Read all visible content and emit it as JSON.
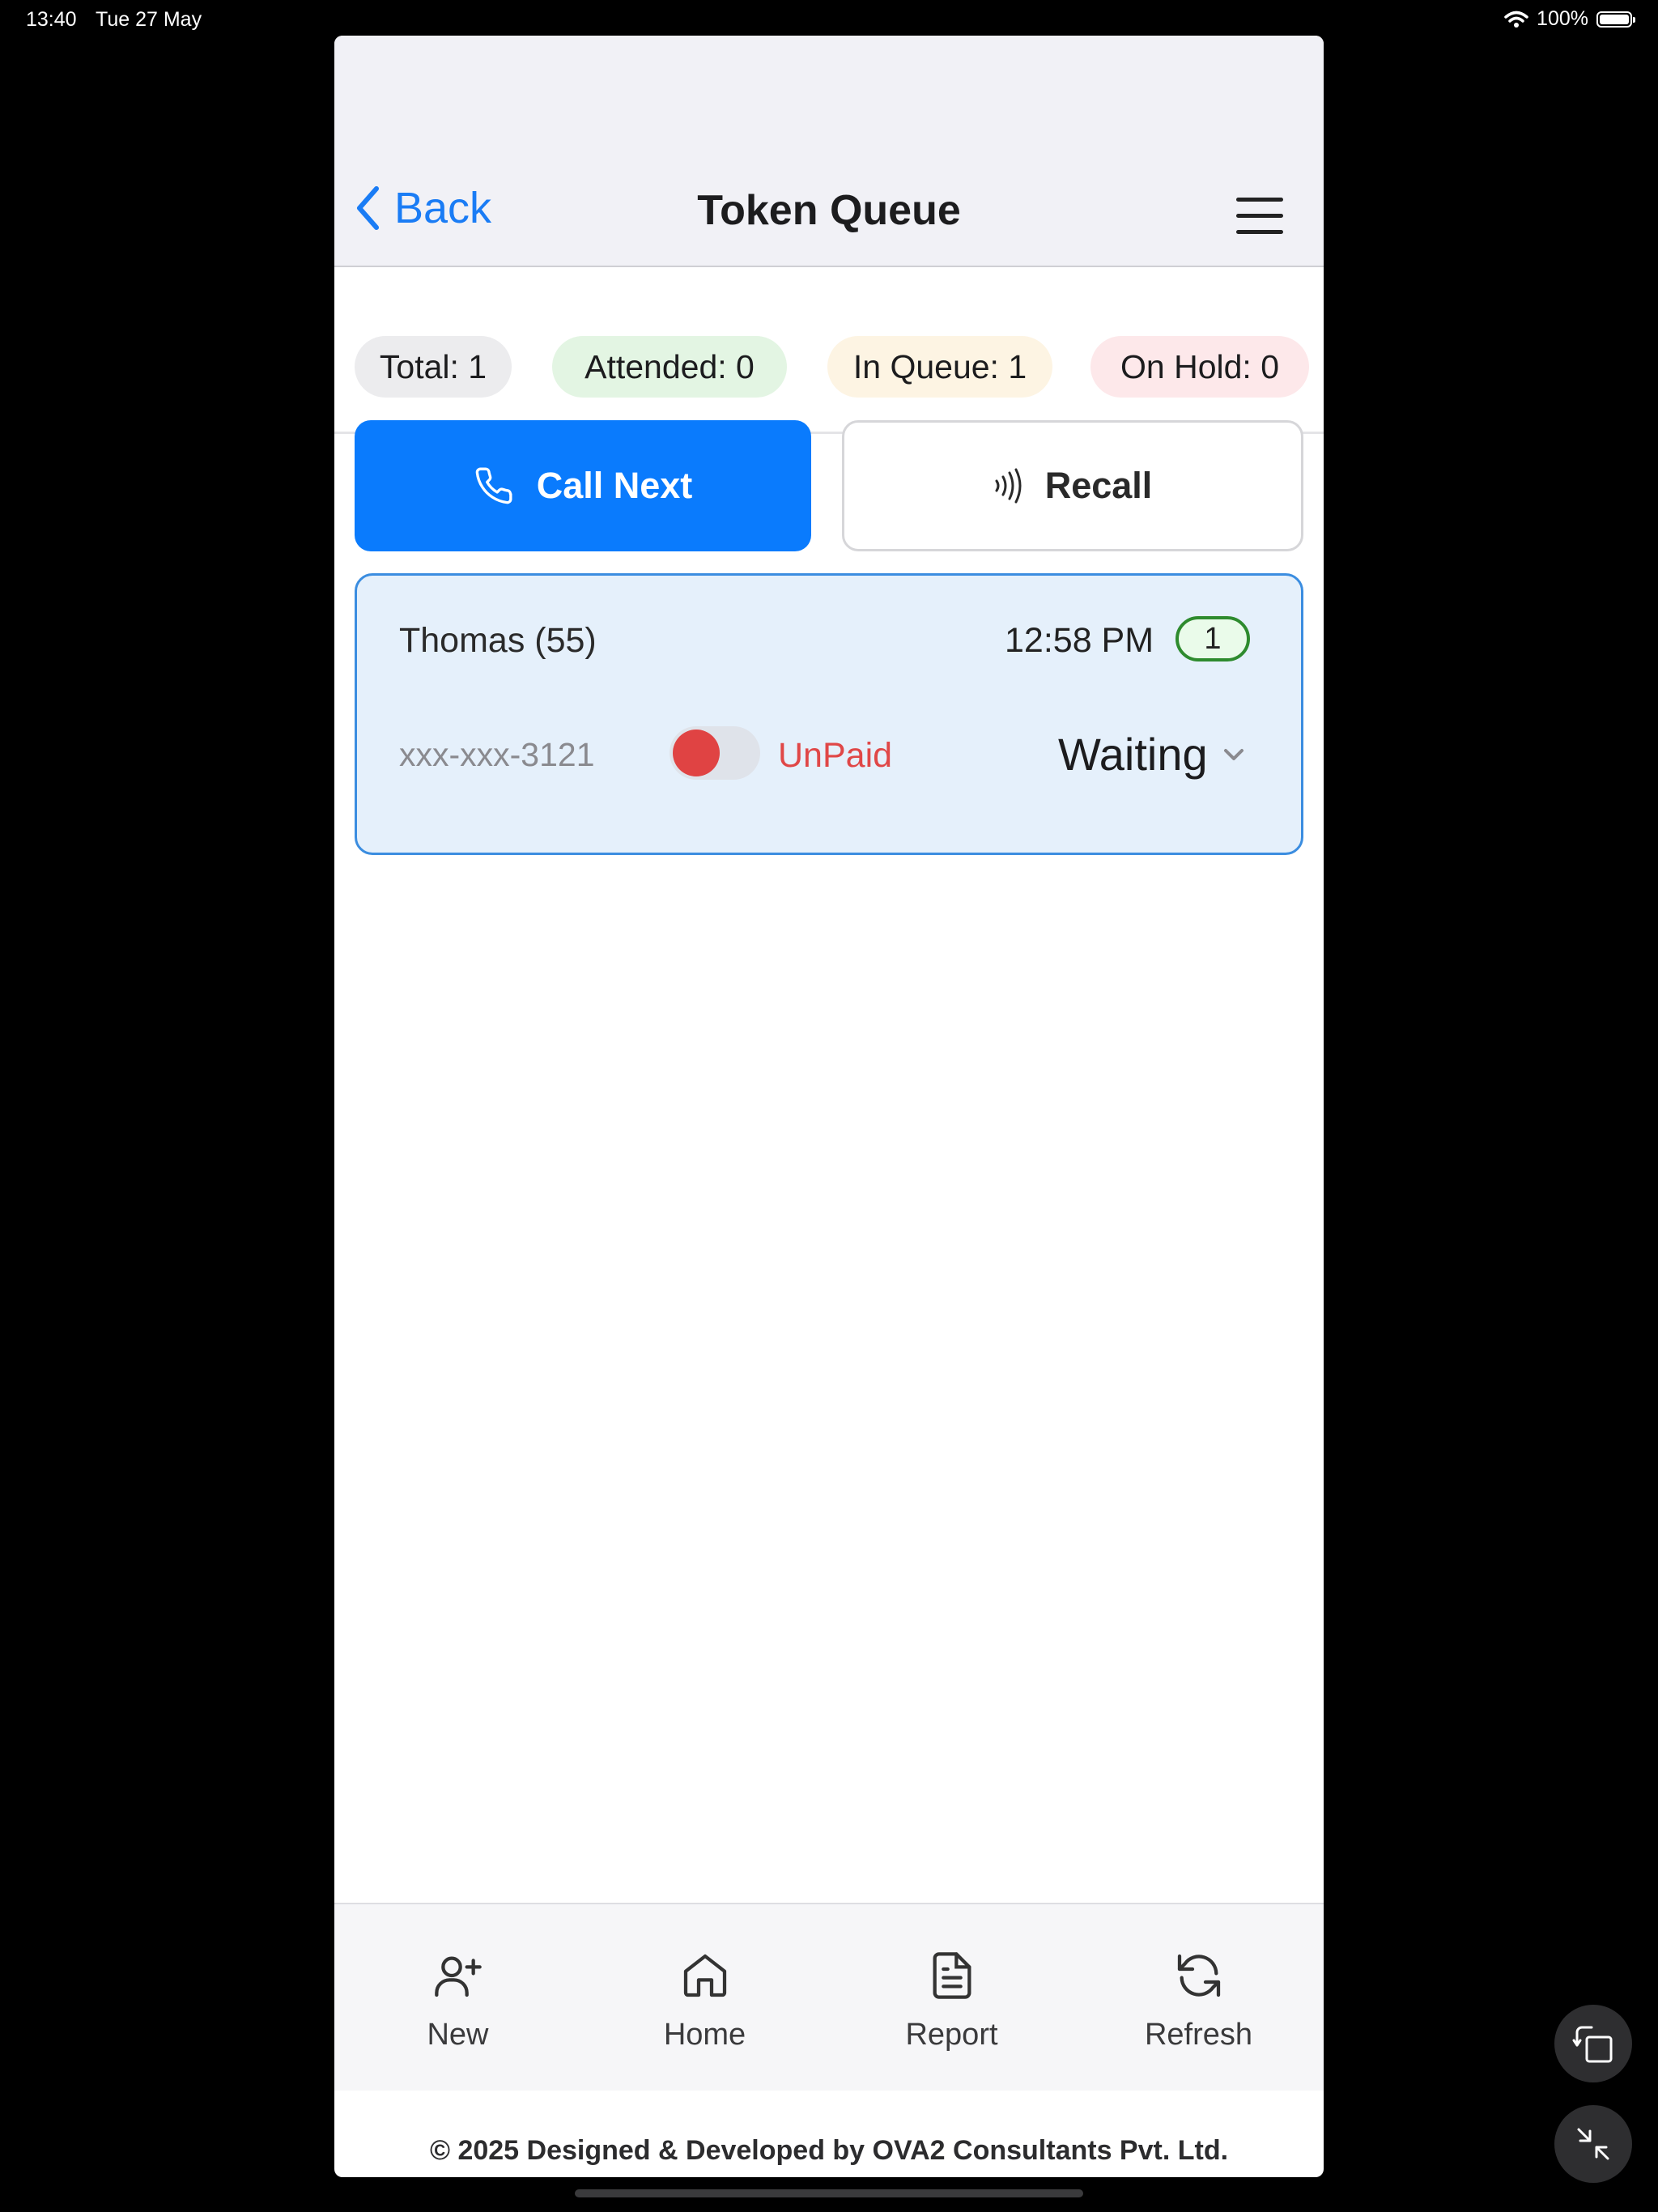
{
  "status_bar": {
    "time": "13:40",
    "date": "Tue 27 May",
    "battery": "100%"
  },
  "header": {
    "back_label": "Back",
    "title": "Token Queue"
  },
  "stats": [
    {
      "label": "Total: 1",
      "color": "#ececee"
    },
    {
      "label": "Attended: 0",
      "color": "#e3f5e3"
    },
    {
      "label": "In Queue: 1",
      "color": "#fdf4e3"
    },
    {
      "label": "On Hold: 0",
      "color": "#fde8ea"
    }
  ],
  "actions": {
    "call_next": "Call Next",
    "recall": "Recall"
  },
  "queue": [
    {
      "name": "Thomas (55)",
      "time": "12:58 PM",
      "token": "1",
      "phone": "xxx-xxx-3121",
      "paid": false,
      "payment_label": "UnPaid",
      "status": "Waiting"
    }
  ],
  "tabs": [
    {
      "label": "New",
      "icon": "user-plus-icon"
    },
    {
      "label": "Home",
      "icon": "home-icon"
    },
    {
      "label": "Report",
      "icon": "report-icon"
    },
    {
      "label": "Refresh",
      "icon": "refresh-icon"
    }
  ],
  "footer": "© 2025 Designed & Developed by OVA2 Consultants Pvt. Ltd.",
  "colors": {
    "accent": "#0a7bfd",
    "unpaid": "#e04747",
    "token_border": "#2e8b2e"
  }
}
